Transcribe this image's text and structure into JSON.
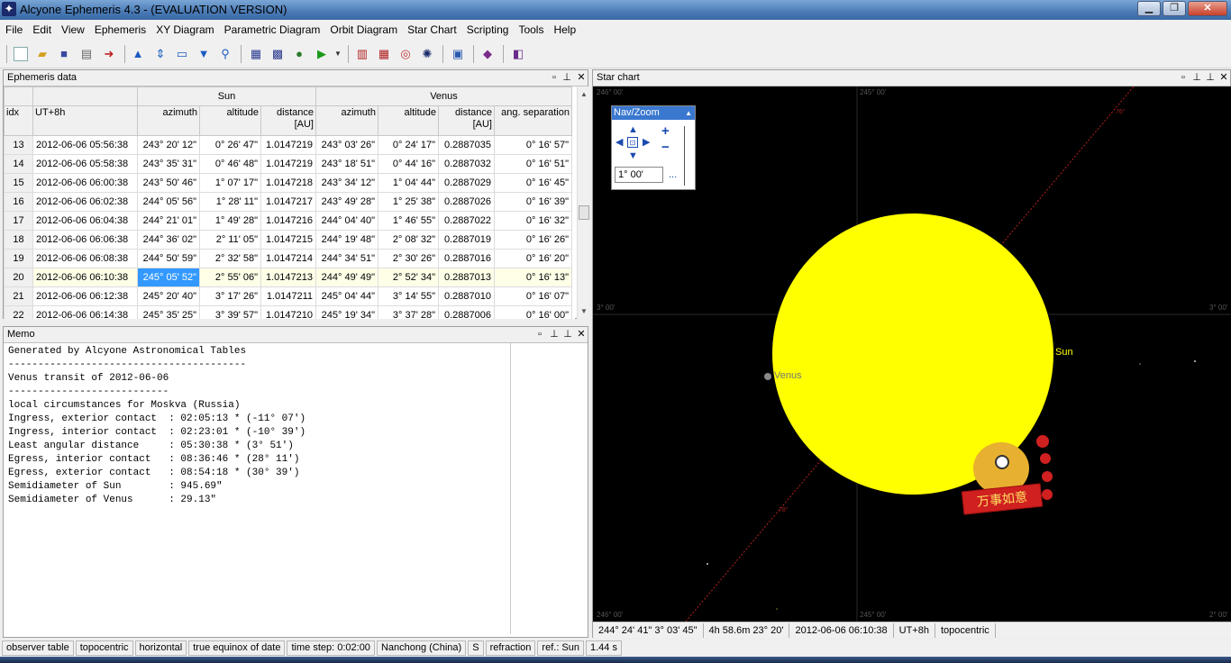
{
  "window": {
    "title": "Alcyone Ephemeris 4.3 - (EVALUATION VERSION)",
    "minimize_glyph": "▁",
    "restore_glyph": "❐",
    "close_glyph": "✕"
  },
  "menu": [
    "File",
    "Edit",
    "View",
    "Ephemeris",
    "XY Diagram",
    "Parametric Diagram",
    "Orbit Diagram",
    "Star Chart",
    "Scripting",
    "Tools",
    "Help"
  ],
  "toolbar_icons": [
    "new-icon",
    "open-icon",
    "save-icon",
    "print-icon",
    "export-icon",
    "move-up-icon",
    "fit-icon",
    "window-icon",
    "move-down-icon",
    "zoom-icon",
    "table-icon",
    "edit-table-icon",
    "globe-icon",
    "play-icon",
    "dropdown-icon",
    "xy-diagram-icon",
    "grid-icon",
    "orbit-icon",
    "star-chart-icon",
    "picture-icon",
    "book-icon",
    "exit-icon"
  ],
  "ephemeris_panel": {
    "title": "Ephemeris data",
    "group_sun": "Sun",
    "group_venus": "Venus",
    "columns": [
      "idx",
      "UT+8h",
      "azimuth",
      "altitude",
      "distance [AU]",
      "azimuth",
      "altitude",
      "distance [AU]",
      "ang. separation"
    ],
    "rows": [
      [
        "13",
        "2012-06-06  05:56:38",
        "243° 20' 12\"",
        "0° 26' 47\"",
        "1.0147219",
        "243° 03' 26\"",
        "0° 24' 17\"",
        "0.2887035",
        "0° 16' 57\""
      ],
      [
        "14",
        "2012-06-06  05:58:38",
        "243° 35' 31\"",
        "0° 46' 48\"",
        "1.0147219",
        "243° 18' 51\"",
        "0° 44' 16\"",
        "0.2887032",
        "0° 16' 51\""
      ],
      [
        "15",
        "2012-06-06  06:00:38",
        "243° 50' 46\"",
        "1° 07' 17\"",
        "1.0147218",
        "243° 34' 12\"",
        "1° 04' 44\"",
        "0.2887029",
        "0° 16' 45\""
      ],
      [
        "16",
        "2012-06-06  06:02:38",
        "244° 05' 56\"",
        "1° 28' 11\"",
        "1.0147217",
        "243° 49' 28\"",
        "1° 25' 38\"",
        "0.2887026",
        "0° 16' 39\""
      ],
      [
        "17",
        "2012-06-06  06:04:38",
        "244° 21' 01\"",
        "1° 49' 28\"",
        "1.0147216",
        "244° 04' 40\"",
        "1° 46' 55\"",
        "0.2887022",
        "0° 16' 32\""
      ],
      [
        "18",
        "2012-06-06  06:06:38",
        "244° 36' 02\"",
        "2° 11' 05\"",
        "1.0147215",
        "244° 19' 48\"",
        "2° 08' 32\"",
        "0.2887019",
        "0° 16' 26\""
      ],
      [
        "19",
        "2012-06-06  06:08:38",
        "244° 50' 59\"",
        "2° 32' 58\"",
        "1.0147214",
        "244° 34' 51\"",
        "2° 30' 26\"",
        "0.2887016",
        "0° 16' 20\""
      ],
      [
        "20",
        "2012-06-06  06:10:38",
        "245° 05' 52\"",
        "2° 55' 06\"",
        "1.0147213",
        "244° 49' 49\"",
        "2° 52' 34\"",
        "0.2887013",
        "0° 16' 13\""
      ],
      [
        "21",
        "2012-06-06  06:12:38",
        "245° 20' 40\"",
        "3° 17' 26\"",
        "1.0147211",
        "245° 04' 44\"",
        "3° 14' 55\"",
        "0.2887010",
        "0° 16' 07\""
      ],
      [
        "22",
        "2012-06-06  06:14:38",
        "245° 35' 25\"",
        "3° 39' 57\"",
        "1.0147210",
        "245° 19' 34\"",
        "3° 37' 28\"",
        "0.2887006",
        "0° 16' 00\""
      ]
    ]
  },
  "memo_panel": {
    "title": "Memo",
    "text": "Generated by Alcyone Astronomical Tables\n----------------------------------------\nVenus transit of 2012-06-06\n---------------------------\nlocal circumstances for Moskva (Russia)\nIngress, exterior contact  : 02:05:13 * (-11° 07')\nIngress, interior contact  : 02:23:01 * (-10° 39')\nLeast angular distance     : 05:30:38 * (3° 51')\nEgress, interior contact   : 08:36:46 * (28° 11')\nEgress, exterior contact   : 08:54:18 * (30° 39')\nSemidiameter of Sun        : 945.69\"\nSemidiameter of Venus      : 29.13\""
  },
  "star_chart": {
    "title": "Star chart",
    "coord_labels": {
      "top_left": "246° 00'",
      "top_mid": "245° 00'",
      "left_mid": "3° 00'",
      "right_mid": "3° 00'",
      "bottom_left": "246° 00'",
      "bottom_mid": "245° 00'",
      "bottom_right": "2° 00'"
    },
    "sun_label": "Sun",
    "venus_label": "Venus",
    "sun_color": "#ffff00",
    "background_color": "#000000",
    "navzoom": {
      "title": "Nav/Zoom",
      "fov_value": "1° 00'",
      "more_label": "..."
    },
    "sticker_text": "万事如意",
    "status": [
      "244° 24' 41\"   3° 03' 45\"",
      "4h 58.6m   23° 20'",
      "2012-06-06  06:10:38",
      "UT+8h",
      "topocentric"
    ]
  },
  "statusbar": [
    "observer table",
    "topocentric",
    "horizontal",
    "true equinox of date",
    "time step: 0:02:00",
    "Nanchong (China)",
    "S",
    "refraction",
    "ref.: Sun",
    "1.44 s"
  ]
}
